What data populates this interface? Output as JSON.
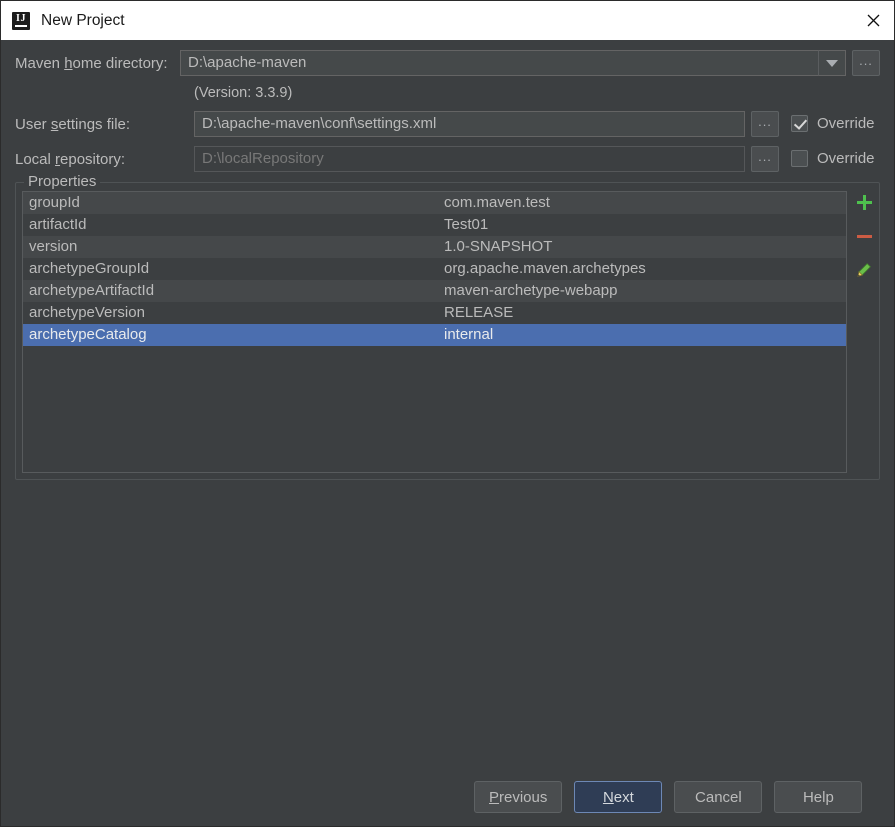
{
  "window": {
    "title": "New Project",
    "icon": "intellij-idea-logo-icon",
    "close_icon": "close-icon"
  },
  "form": {
    "maven_home": {
      "label_prefix": "Maven ",
      "label_mnemonic": "h",
      "label_suffix": "ome directory:",
      "value": "D:\\apache-maven",
      "dropdown_icon": "chevron-down-icon",
      "browse_label": "..."
    },
    "version_note": "(Version: 3.3.9)",
    "user_settings": {
      "label_prefix": "User ",
      "label_mnemonic": "s",
      "label_suffix": "ettings file:",
      "value": "D:\\apache-maven\\conf\\settings.xml",
      "browse_label": "...",
      "override_label": "Override",
      "override_checked": true
    },
    "local_repository": {
      "label_prefix": "Local ",
      "label_mnemonic": "r",
      "label_suffix": "epository:",
      "value": "D:\\localRepository",
      "browse_label": "...",
      "override_label": "Override",
      "override_checked": false,
      "disabled": true
    }
  },
  "properties": {
    "group_title": "Properties",
    "selected_index": 6,
    "rows": [
      {
        "key": "groupId",
        "value": "com.maven.test"
      },
      {
        "key": "artifactId",
        "value": "Test01"
      },
      {
        "key": "version",
        "value": "1.0-SNAPSHOT"
      },
      {
        "key": "archetypeGroupId",
        "value": "org.apache.maven.archetypes"
      },
      {
        "key": "archetypeArtifactId",
        "value": "maven-archetype-webapp"
      },
      {
        "key": "archetypeVersion",
        "value": "RELEASE"
      },
      {
        "key": "archetypeCatalog",
        "value": "internal"
      }
    ],
    "actions": [
      {
        "name": "add-property-button",
        "icon": "plus-icon",
        "color": "#4ec14e"
      },
      {
        "name": "remove-property-button",
        "icon": "minus-icon",
        "color": "#cc5c44"
      },
      {
        "name": "edit-property-button",
        "icon": "pencil-icon",
        "color": "#6bbf4a"
      }
    ]
  },
  "footer": {
    "buttons": [
      {
        "name": "previous-button",
        "prefix": "",
        "mnemonic": "P",
        "suffix": "revious",
        "default": false
      },
      {
        "name": "next-button",
        "prefix": "",
        "mnemonic": "N",
        "suffix": "ext",
        "default": true
      },
      {
        "name": "cancel-button",
        "prefix": "Cancel",
        "mnemonic": "",
        "suffix": "",
        "default": false
      },
      {
        "name": "help-button",
        "prefix": "Help",
        "mnemonic": "",
        "suffix": "",
        "default": false
      }
    ]
  },
  "colors": {
    "dialog_bg": "#3c3f41",
    "field_bg": "#45494a",
    "row_bg": "#45484a",
    "row_alt_bg": "#3c3f41",
    "selection": "#4b6eaf",
    "text": "#bbbbbb",
    "titlebar_bg": "#ffffff",
    "default_button_bg": "#2f3d55"
  }
}
